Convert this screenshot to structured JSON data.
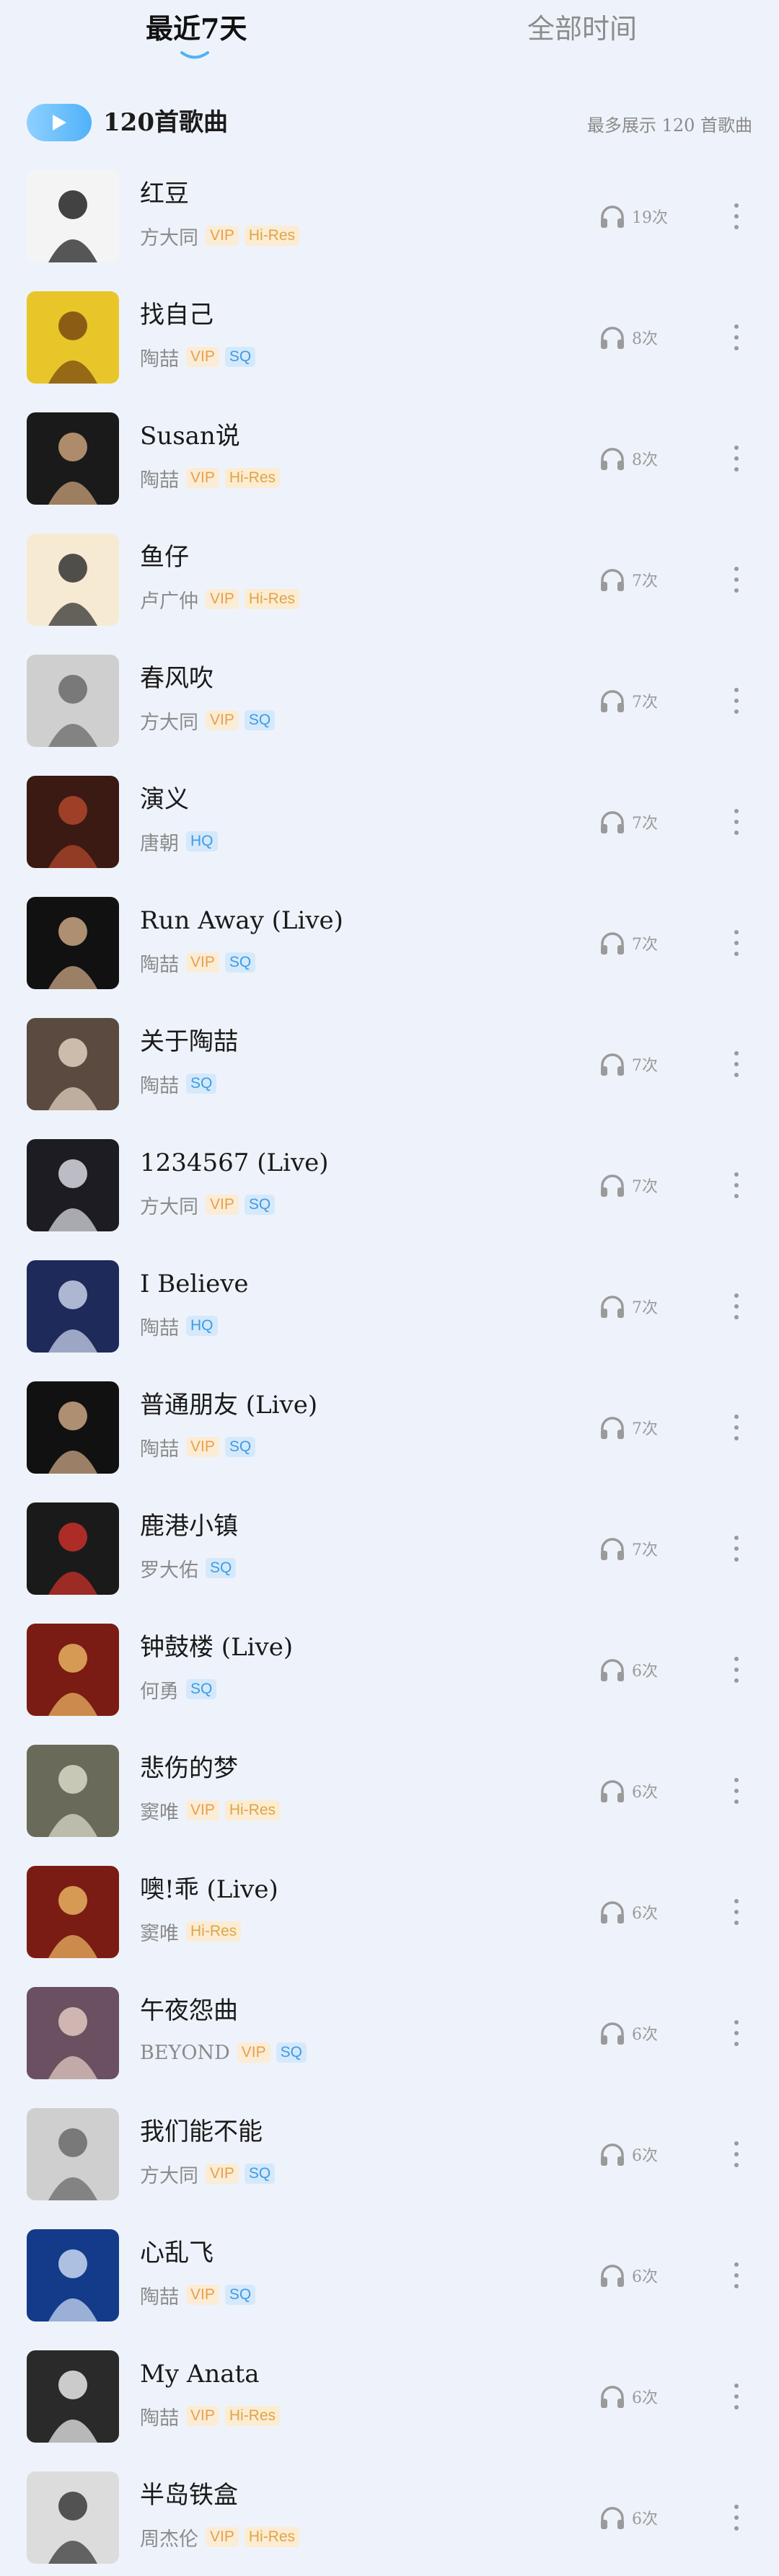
{
  "tabs": {
    "recent": "最近7天",
    "all": "全部时间"
  },
  "play_all": {
    "count_label": "120首歌曲",
    "note": "最多展示 120 首歌曲"
  },
  "colors": {
    "accent": "#4fb2f8",
    "background": "#eef3fb"
  },
  "songs": [
    {
      "title": "红豆",
      "artist": "方大同",
      "badges": [
        "VIP",
        "Hi-Res"
      ],
      "plays": "19次",
      "cover_bg": "#f4f4f4",
      "cover_fg": "#222222"
    },
    {
      "title": "找自己",
      "artist": "陶喆",
      "badges": [
        "VIP",
        "SQ"
      ],
      "plays": "8次",
      "cover_bg": "#e8c62a",
      "cover_fg": "#7a4a10"
    },
    {
      "title": "Susan说",
      "artist": "陶喆",
      "badges": [
        "VIP",
        "Hi-Res"
      ],
      "plays": "8次",
      "cover_bg": "#1a1a1a",
      "cover_fg": "#c9a07a"
    },
    {
      "title": "鱼仔",
      "artist": "卢广仲",
      "badges": [
        "VIP",
        "Hi-Res"
      ],
      "plays": "7次",
      "cover_bg": "#f6ead2",
      "cover_fg": "#333333"
    },
    {
      "title": "春风吹",
      "artist": "方大同",
      "badges": [
        "VIP",
        "SQ"
      ],
      "plays": "7次",
      "cover_bg": "#cfcfcf",
      "cover_fg": "#6a6a6a"
    },
    {
      "title": "演义",
      "artist": "唐朝",
      "badges": [
        "HQ"
      ],
      "plays": "7次",
      "cover_bg": "#3a1a12",
      "cover_fg": "#b0472c"
    },
    {
      "title": "Run Away (Live)",
      "artist": "陶喆",
      "badges": [
        "VIP",
        "SQ"
      ],
      "plays": "7次",
      "cover_bg": "#111111",
      "cover_fg": "#caa684"
    },
    {
      "title": "关于陶喆",
      "artist": "陶喆",
      "badges": [
        "SQ"
      ],
      "plays": "7次",
      "cover_bg": "#5a4a40",
      "cover_fg": "#e0d0c0"
    },
    {
      "title": "1234567 (Live)",
      "artist": "方大同",
      "badges": [
        "VIP",
        "SQ"
      ],
      "plays": "7次",
      "cover_bg": "#1c1c22",
      "cover_fg": "#d8d8e0"
    },
    {
      "title": "I Believe",
      "artist": "陶喆",
      "badges": [
        "HQ"
      ],
      "plays": "7次",
      "cover_bg": "#1e2a5a",
      "cover_fg": "#c8d0e8"
    },
    {
      "title": "普通朋友 (Live)",
      "artist": "陶喆",
      "badges": [
        "VIP",
        "SQ"
      ],
      "plays": "7次",
      "cover_bg": "#111111",
      "cover_fg": "#caa684"
    },
    {
      "title": "鹿港小镇",
      "artist": "罗大佑",
      "badges": [
        "SQ"
      ],
      "plays": "7次",
      "cover_bg": "#1a1a1a",
      "cover_fg": "#c8302a"
    },
    {
      "title": "钟鼓楼 (Live)",
      "artist": "何勇",
      "badges": [
        "SQ"
      ],
      "plays": "6次",
      "cover_bg": "#7a1c14",
      "cover_fg": "#e8b060"
    },
    {
      "title": "悲伤的梦",
      "artist": "窦唯",
      "badges": [
        "VIP",
        "Hi-Res"
      ],
      "plays": "6次",
      "cover_bg": "#6a6a5a",
      "cover_fg": "#d8d8c8"
    },
    {
      "title": "噢!乖 (Live)",
      "artist": "窦唯",
      "badges": [
        "Hi-Res"
      ],
      "plays": "6次",
      "cover_bg": "#7a1c14",
      "cover_fg": "#e8b060"
    },
    {
      "title": "午夜怨曲",
      "artist": "BEYOND",
      "badges": [
        "VIP",
        "SQ"
      ],
      "plays": "6次",
      "cover_bg": "#6a5060",
      "cover_fg": "#e0c8c0"
    },
    {
      "title": "我们能不能",
      "artist": "方大同",
      "badges": [
        "VIP",
        "SQ"
      ],
      "plays": "6次",
      "cover_bg": "#cfcfcf",
      "cover_fg": "#6a6a6a"
    },
    {
      "title": "心乱飞",
      "artist": "陶喆",
      "badges": [
        "VIP",
        "SQ"
      ],
      "plays": "6次",
      "cover_bg": "#143a8a",
      "cover_fg": "#c8d8f0"
    },
    {
      "title": "My Anata",
      "artist": "陶喆",
      "badges": [
        "VIP",
        "Hi-Res"
      ],
      "plays": "6次",
      "cover_bg": "#2a2a2a",
      "cover_fg": "#e8e8e8"
    },
    {
      "title": "半岛铁盒",
      "artist": "周杰伦",
      "badges": [
        "VIP",
        "Hi-Res"
      ],
      "plays": "6次",
      "cover_bg": "#dcdcdc",
      "cover_fg": "#3a3a3a"
    }
  ]
}
